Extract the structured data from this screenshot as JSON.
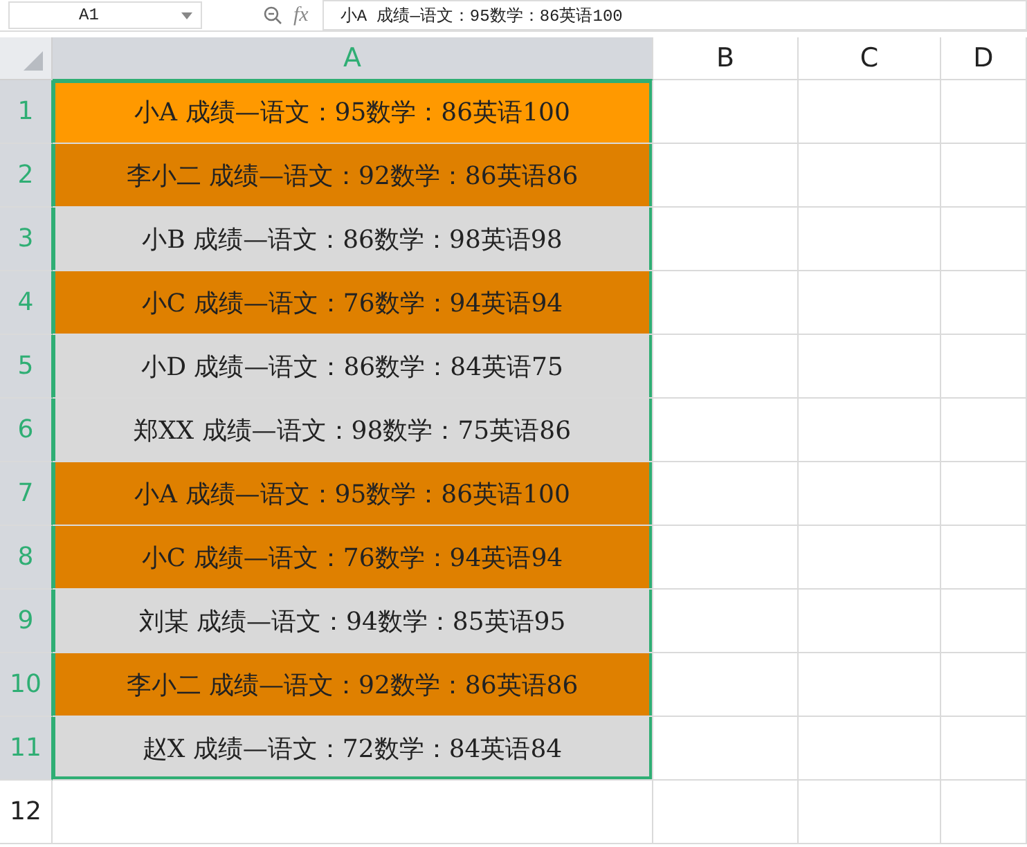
{
  "formula_bar": {
    "name_box": "A1",
    "function_label": "fx",
    "formula": "小A 成绩—语文：95数学：86英语100"
  },
  "columns": [
    {
      "label": "A",
      "selected": true
    },
    {
      "label": "B",
      "selected": false
    },
    {
      "label": "C",
      "selected": false
    },
    {
      "label": "D",
      "selected": false
    }
  ],
  "rows": [
    {
      "number": "1",
      "selected": true,
      "cell": {
        "text": "小A 成绩—语文：95数学：86英语100",
        "color": "#ff9900"
      }
    },
    {
      "number": "2",
      "selected": true,
      "cell": {
        "text": "李小二 成绩—语文：92数学：86英语86",
        "color": "#df8000"
      }
    },
    {
      "number": "3",
      "selected": true,
      "cell": {
        "text": "小B 成绩—语文：86数学：98英语98",
        "color": "#d9d9d9"
      }
    },
    {
      "number": "4",
      "selected": true,
      "cell": {
        "text": "小C 成绩—语文：76数学：94英语94",
        "color": "#df8000"
      }
    },
    {
      "number": "5",
      "selected": true,
      "cell": {
        "text": "小D 成绩—语文：86数学：84英语75",
        "color": "#d9d9d9"
      }
    },
    {
      "number": "6",
      "selected": true,
      "cell": {
        "text": "郑XX 成绩—语文：98数学：75英语86",
        "color": "#d9d9d9"
      }
    },
    {
      "number": "7",
      "selected": true,
      "cell": {
        "text": "小A 成绩—语文：95数学：86英语100",
        "color": "#df8000"
      }
    },
    {
      "number": "8",
      "selected": true,
      "cell": {
        "text": "小C 成绩—语文：76数学：94英语94",
        "color": "#df8000"
      }
    },
    {
      "number": "9",
      "selected": true,
      "cell": {
        "text": "刘某 成绩—语文：94数学：85英语95",
        "color": "#d9d9d9"
      }
    },
    {
      "number": "10",
      "selected": true,
      "cell": {
        "text": "李小二 成绩—语文：92数学：86英语86",
        "color": "#df8000"
      }
    },
    {
      "number": "11",
      "selected": true,
      "cell": {
        "text": "赵X 成绩—语文：72数学：84英语84",
        "color": "#d9d9d9"
      }
    },
    {
      "number": "12",
      "selected": false
    }
  ]
}
